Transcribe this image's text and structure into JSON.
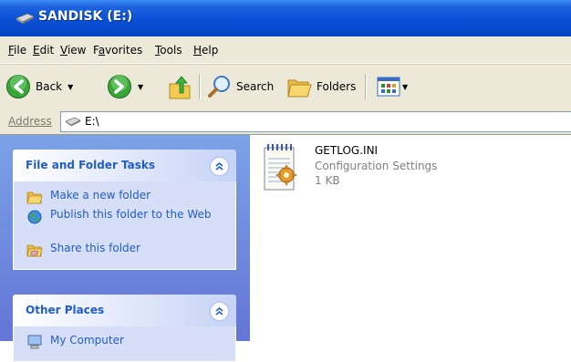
{
  "window": {
    "title": "SANDISK (E:)",
    "icon": "drive-icon"
  },
  "menu": [
    {
      "label": "File",
      "key": "F",
      "rest": "ile"
    },
    {
      "label": "Edit",
      "key": "E",
      "rest": "dit"
    },
    {
      "label": "View",
      "key": "V",
      "rest": "iew"
    },
    {
      "label": "Favorites",
      "key": "a",
      "rest": "vorites",
      "pre": "F"
    },
    {
      "label": "Tools",
      "key": "T",
      "rest": "ools"
    },
    {
      "label": "Help",
      "key": "H",
      "rest": "elp"
    }
  ],
  "toolbar": {
    "back_label": "Back",
    "search_label": "Search",
    "folders_label": "Folders"
  },
  "address": {
    "label": "Address",
    "value": "E:\\"
  },
  "left_pane": {
    "file_tasks": {
      "title": "File and Folder Tasks",
      "items": [
        {
          "label": "Make a new folder",
          "icon": "new-folder-icon"
        },
        {
          "label": "Publish this folder to the Web",
          "icon": "globe-icon"
        },
        {
          "label": "Share this folder",
          "icon": "share-folder-icon"
        }
      ]
    },
    "other_places": {
      "title": "Other Places",
      "items": [
        {
          "label": "My Computer",
          "icon": "computer-icon"
        }
      ]
    }
  },
  "files": [
    {
      "name": "GETLOG.INI",
      "type": "Configuration Settings",
      "size": "1 KB",
      "icon": "config-file-icon"
    }
  ],
  "colors": {
    "titlebar": "#0a4fd6",
    "link": "#215dc6",
    "chrome": "#ece9d8",
    "task_pane_bg": "#d6dff7"
  }
}
